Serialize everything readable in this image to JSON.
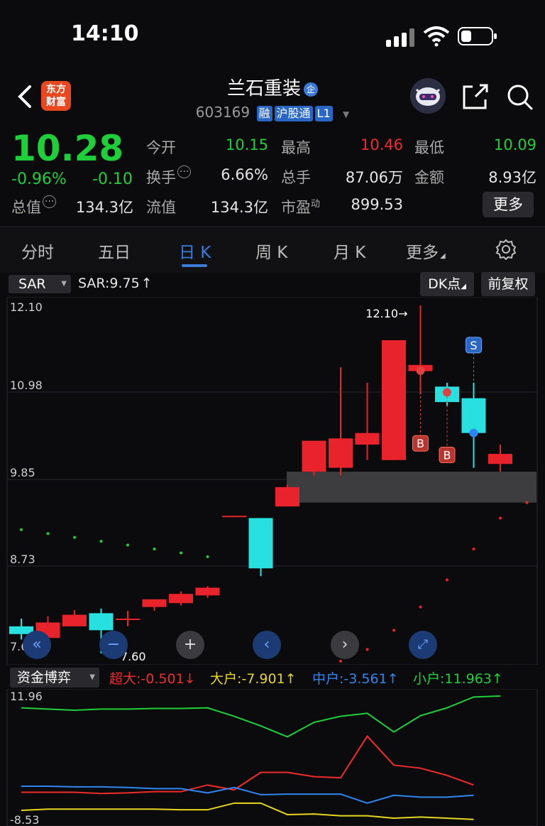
{
  "status_bar": {
    "time": "14:10"
  },
  "header": {
    "logo_text": "东方\n财富",
    "title": "兰石重装",
    "title_badge": "企",
    "code": "603169",
    "tags": [
      "融",
      "沪股通",
      "L1"
    ]
  },
  "quote": {
    "price": "10.28",
    "change_pct": "-0.96%",
    "change": "-0.10",
    "fields": [
      {
        "label": "今开",
        "value": "10.15",
        "color": "#1fcf3a"
      },
      {
        "label": "最高",
        "value": "10.46",
        "color": "#f02b2b"
      },
      {
        "label": "最低",
        "value": "10.09",
        "color": "#1fcf3a"
      },
      {
        "label": "换手",
        "value": "6.66%",
        "color": "#e6e6e6"
      },
      {
        "label": "总手",
        "value": "87.06万",
        "color": "#e6e6e6"
      },
      {
        "label": "金额",
        "value": "8.93亿",
        "color": "#e6e6e6"
      },
      {
        "label": "总值",
        "value": "134.3亿",
        "color": "#e6e6e6"
      },
      {
        "label": "流值",
        "value": "134.3亿",
        "color": "#e6e6e6"
      },
      {
        "label": "市盈",
        "label_sup": "动",
        "value": "899.53",
        "color": "#e6e6e6"
      }
    ],
    "more_label": "更多"
  },
  "tabs": [
    "分时",
    "五日",
    "日 K",
    "周 K",
    "月 K",
    "更多"
  ],
  "active_tab": "日 K",
  "toolbar": {
    "indicator": "SAR",
    "indicator_value": "SAR:9.75",
    "dk_label": "DK点",
    "adjust_label": "前复权"
  },
  "chart_data": {
    "type": "candlestick",
    "y_ticks": [
      "12.10",
      "10.98",
      "9.85",
      "8.73",
      "7.60"
    ],
    "ylim": [
      7.6,
      12.1
    ],
    "max_marker": "12.10",
    "min_marker": "7.60",
    "colors": {
      "up": "#e8232b",
      "down": "#28e0e0",
      "sar_up": "#1fcf3a",
      "sar_down": "#e8232b"
    },
    "candles": [
      {
        "o": 7.95,
        "h": 8.05,
        "l": 7.78,
        "c": 7.85
      },
      {
        "o": 7.8,
        "h": 8.08,
        "l": 7.75,
        "c": 8.0
      },
      {
        "o": 7.95,
        "h": 8.16,
        "l": 7.95,
        "c": 8.1
      },
      {
        "o": 8.12,
        "h": 8.18,
        "l": 7.6,
        "c": 7.9
      },
      {
        "o": 8.05,
        "h": 8.15,
        "l": 7.95,
        "c": 8.05
      },
      {
        "o": 8.2,
        "h": 8.3,
        "l": 8.15,
        "c": 8.3
      },
      {
        "o": 8.25,
        "h": 8.4,
        "l": 8.22,
        "c": 8.37
      },
      {
        "o": 8.35,
        "h": 8.47,
        "l": 8.32,
        "c": 8.45
      },
      {
        "o": 9.37,
        "h": 9.38,
        "l": 9.37,
        "c": 9.38
      },
      {
        "o": 9.35,
        "h": 9.35,
        "l": 8.6,
        "c": 8.7
      },
      {
        "o": 9.5,
        "h": 9.78,
        "l": 9.5,
        "c": 9.75
      },
      {
        "o": 9.95,
        "h": 10.35,
        "l": 9.9,
        "c": 10.35
      },
      {
        "o": 10.0,
        "h": 11.3,
        "l": 9.9,
        "c": 10.38
      },
      {
        "o": 10.3,
        "h": 11.1,
        "l": 10.1,
        "c": 10.45
      },
      {
        "o": 10.1,
        "h": 11.3,
        "l": 10.1,
        "c": 11.65
      },
      {
        "o": 11.25,
        "h": 12.1,
        "l": 10.95,
        "c": 11.33
      },
      {
        "o": 11.05,
        "h": 11.1,
        "l": 10.8,
        "c": 10.85
      },
      {
        "o": 10.9,
        "h": 11.1,
        "l": 10.0,
        "c": 10.45
      },
      {
        "o": 10.05,
        "h": 10.3,
        "l": 9.95,
        "c": 10.18
      }
    ],
    "sar": [
      9.2,
      9.15,
      9.1,
      9.05,
      9.0,
      8.95,
      8.9,
      8.85,
      null,
      null,
      null,
      null,
      7.5,
      7.65,
      7.9,
      8.2,
      8.55,
      8.95,
      9.35,
      9.55
    ],
    "dk_signals": [
      {
        "index": 15,
        "label": "B"
      },
      {
        "index": 16,
        "label": "B"
      },
      {
        "index": 17,
        "label": "S"
      }
    ]
  },
  "fund_flow": {
    "selector": "资金博弈",
    "items": [
      {
        "label": "超大:-0.501",
        "arrow": "↓",
        "color": "#f02b2b"
      },
      {
        "label": "大户:-7.901",
        "arrow": "↑",
        "color": "#e6d61f"
      },
      {
        "label": "中户:-3.561",
        "arrow": "↑",
        "color": "#2e86f0"
      },
      {
        "label": "小户:11.963",
        "arrow": "↑",
        "color": "#1fcf3a"
      }
    ],
    "y_ticks": [
      "11.96",
      "-8.53"
    ],
    "ylim": [
      -8.53,
      11.96
    ],
    "series": [
      {
        "color": "#1fcf3a",
        "values": [
          10.0,
          9.8,
          9.6,
          9.8,
          9.8,
          9.9,
          9.9,
          10.0,
          8.6,
          7.0,
          5.2,
          7.6,
          8.6,
          9.1,
          6.0,
          8.7,
          10.0,
          11.8,
          11.96
        ]
      },
      {
        "color": "#f02b2b",
        "values": [
          -4.0,
          -4.0,
          -4.0,
          -4.2,
          -4.1,
          -3.9,
          -3.9,
          -2.8,
          -3.6,
          -0.7,
          -0.7,
          -1.4,
          -1.6,
          5.3,
          0.5,
          0.0,
          -1.2,
          -2.8
        ]
      },
      {
        "color": "#2e86f0",
        "values": [
          -3.0,
          -3.0,
          -3.1,
          -3.1,
          -3.2,
          -3.4,
          -3.4,
          -4.1,
          -3.2,
          -4.4,
          -4.3,
          -4.3,
          -4.3,
          -5.8,
          -4.5,
          -4.8,
          -4.8,
          -4.5
        ]
      },
      {
        "color": "#e6d61f",
        "values": [
          -7.0,
          -6.8,
          -6.8,
          -6.8,
          -6.8,
          -6.8,
          -6.9,
          -6.9,
          -5.8,
          -5.8,
          -7.7,
          -7.6,
          -7.9,
          -7.9,
          -8.3,
          -8.1,
          -8.3,
          -8.5
        ]
      }
    ]
  }
}
